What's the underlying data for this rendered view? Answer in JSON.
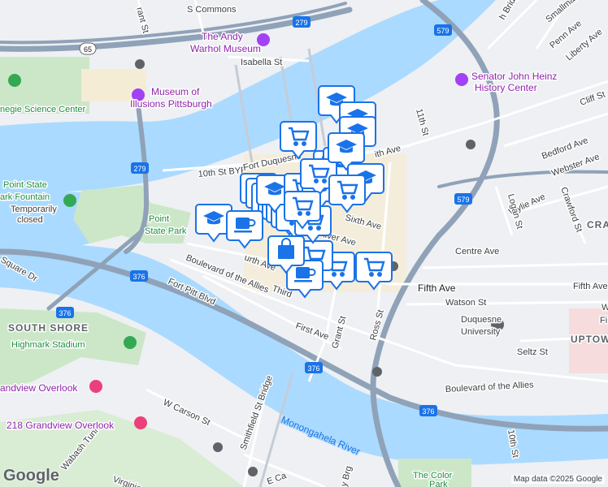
{
  "map": {
    "credit": "Map data ©2025 Google",
    "logo": "Google",
    "colors": {
      "water": "#aadaff",
      "land": "#eef0f3",
      "park": "#cbe7c8",
      "highway": "#8fa2b8",
      "marker": "#1a73e8"
    },
    "street_labels": {
      "s_commons": "S Commons",
      "grant_st_top": "rant St",
      "isabella_st": "Isabella St",
      "tenth_st_byp": "10th St BYP",
      "fort_duquesne": "Fort Duquesne",
      "eleventh_st": "11th St",
      "penn_ave": "Penn Ave",
      "liberty_ave": "Liberty Ave",
      "smallman": "Smallman",
      "bridge": "h Bridge",
      "cliff_st": "Cliff St",
      "bedford_ave": "Bedford Ave",
      "webster_ave": "Webster Ave",
      "wylie_ave": "Wylie Ave",
      "logan_st": "Logan St",
      "crawford_st": "Crawford St",
      "centre_ave": "Centre Ave",
      "fifth_ave": "Fifth Ave",
      "fifth_ave_east": "Fifth Ave",
      "watson_st": "Watson St",
      "seltz_st": "Seltz St",
      "grant_st": "Grant St",
      "ross_st": "Ross St",
      "first_ave": "First Ave",
      "fort_pitt_blvd": "Fort Pitt Blvd",
      "boulevard_allies": "Boulevard of the Allies",
      "boulevard_allies_east": "Boulevard of the Allies",
      "third_ave": "Third",
      "fourth_ave": "urth Ave",
      "liberty_ave_mid": "iberty Ave",
      "oliver_ave": "liver Ave",
      "sixth_ave": "Sixth Ave",
      "ith_ave": "ith Ave",
      "square_dr": "Square Dr",
      "w_carson_st": "W Carson St",
      "smithfield_bridge": "Smithfield St Bridge",
      "wabash_tunl": "Wabash Tunl",
      "virginia": "Virginia",
      "e_ca": "E Ca",
      "tenth_st_s": "10th St",
      "y_brg": "y Brg",
      "cra": "CRA",
      "fifth_w": "W",
      "fifth_fi": "Fi"
    },
    "poi_labels": {
      "andy_warhol_line1": "The Andy",
      "andy_warhol_line2": "Warhol Museum",
      "heinz_line1": "Senator John Heinz",
      "heinz_line2": "History Center",
      "illusions_line1": "Museum of",
      "illusions_line2": "Illusions Pittsburgh",
      "science_center": "negie Science Center",
      "fountain_line1": "Point State",
      "fountain_line2": "ark Fountain",
      "fountain_line3": "Temporarily",
      "fountain_line4": "closed",
      "point_park_line1": "Point",
      "point_park_line2": "State Park",
      "highmark": "Highmark Stadium",
      "duquesne_line1": "Duquesne",
      "duquesne_line2": "University",
      "grandview": "andview Overlook",
      "grandview218": "218 Grandview Overlook",
      "color_park_line1": "The Color",
      "color_park_line2": "Park"
    },
    "district_labels": {
      "south_shore": "SOUTH SHORE",
      "uptown": "UPTOWN"
    },
    "river_labels": {
      "monongahela": "Monongahela River"
    },
    "highway_shields": [
      "279",
      "579",
      "65",
      "279",
      "579",
      "376",
      "376",
      "376",
      "376"
    ],
    "markers": [
      {
        "icon": "school-icon"
      },
      {
        "icon": "school-icon"
      },
      {
        "icon": "school-icon"
      },
      {
        "icon": "school-icon"
      },
      {
        "icon": "school-icon"
      },
      {
        "icon": "school-icon"
      },
      {
        "icon": "grocery-cart-icon"
      },
      {
        "icon": "grocery-cart-icon"
      },
      {
        "icon": "grocery-cart-icon"
      },
      {
        "icon": "grocery-cart-icon"
      },
      {
        "icon": "grocery-cart-icon"
      },
      {
        "icon": "grocery-cart-icon"
      },
      {
        "icon": "grocery-cart-icon"
      },
      {
        "icon": "coffee-cup-icon"
      },
      {
        "icon": "coffee-cup-icon"
      },
      {
        "icon": "shopping-bag-icon"
      }
    ]
  }
}
